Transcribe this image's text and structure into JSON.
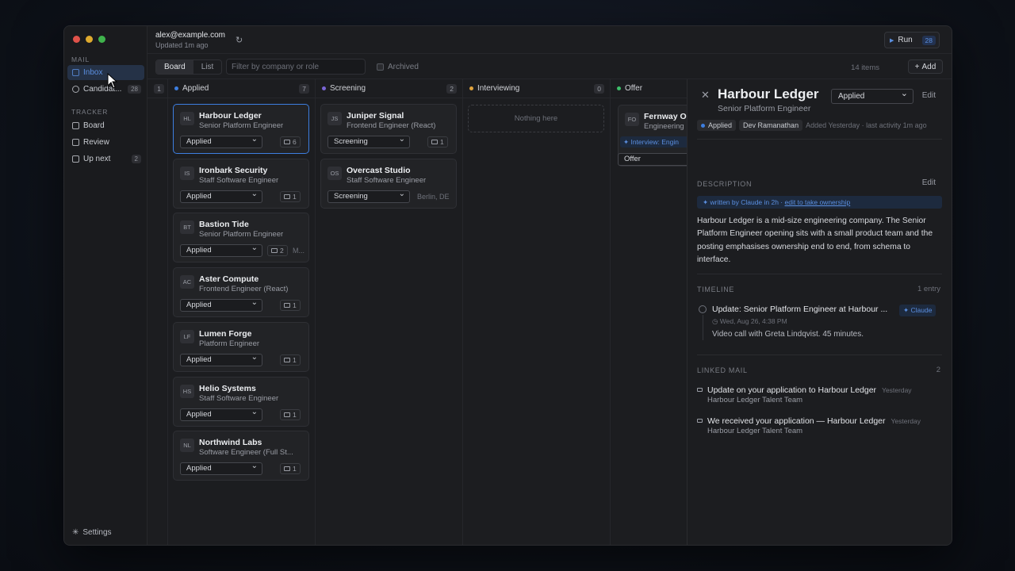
{
  "sidebar": {
    "mail_label": "MAIL",
    "tracker_label": "TRACKER",
    "items": [
      {
        "label": "Inbox"
      },
      {
        "label": "Candidat...",
        "count": "28"
      },
      {
        "label": "Board"
      },
      {
        "label": "Review"
      },
      {
        "label": "Up next",
        "count": "2"
      }
    ],
    "settings": "Settings"
  },
  "topbar": {
    "account": "alex@example.com",
    "updated": "Updated 1m ago",
    "run_label": "Run",
    "run_count": "28"
  },
  "toolbar": {
    "view_board": "Board",
    "view_list": "List",
    "filter_placeholder": "Filter by company or role",
    "archived_label": "Archived",
    "items_count": "14 items",
    "add_label": "Add"
  },
  "columns": [
    {
      "name": "",
      "count": "1"
    },
    {
      "name": "Applied",
      "count": "7",
      "color": "#3d7ee0"
    },
    {
      "name": "Screening",
      "count": "2",
      "color": "#7a66d6"
    },
    {
      "name": "Interviewing",
      "count": "0",
      "color": "#e0a33d",
      "empty_text": "Nothing here"
    },
    {
      "name": "Offer",
      "color": "#3dbf6a"
    }
  ],
  "applied_cards": [
    {
      "initials": "HL",
      "name": "Harbour Ledger",
      "role": "Senior Platform Engineer",
      "stage": "Applied",
      "mail": "6"
    },
    {
      "initials": "IS",
      "name": "Ironbark Security",
      "role": "Staff Software Engineer",
      "stage": "Applied",
      "mail": "1"
    },
    {
      "initials": "BT",
      "name": "Bastion Tide",
      "role": "Senior Platform Engineer",
      "stage": "Applied",
      "mail": "2",
      "extra": "M..."
    },
    {
      "initials": "AC",
      "name": "Aster Compute",
      "role": "Frontend Engineer (React)",
      "stage": "Applied",
      "mail": "1"
    },
    {
      "initials": "LF",
      "name": "Lumen Forge",
      "role": "Platform Engineer",
      "stage": "Applied",
      "mail": "1"
    },
    {
      "initials": "HS",
      "name": "Helio Systems",
      "role": "Staff Software Engineer",
      "stage": "Applied",
      "mail": "1"
    },
    {
      "initials": "NL",
      "name": "Northwind Labs",
      "role": "Software Engineer (Full St...",
      "stage": "Applied",
      "mail": "1"
    }
  ],
  "screening_cards": [
    {
      "initials": "JS",
      "name": "Juniper Signal",
      "role": "Frontend Engineer (React)",
      "stage": "Screening",
      "mail": "1"
    },
    {
      "initials": "OS",
      "name": "Overcast Studio",
      "role": "Staff Software Engineer",
      "stage": "Screening",
      "extra": "Berlin, DE"
    }
  ],
  "offer_cards": [
    {
      "initials": "FO",
      "name": "Fernway Op",
      "role": "Engineering",
      "note": "Interview: Engin",
      "stage": "Offer"
    }
  ],
  "detail": {
    "title": "Harbour Ledger",
    "subtitle": "Senior Platform Engineer",
    "stage": "Applied",
    "edit": "Edit",
    "tag_stage": "Applied",
    "tag_person": "Dev Ramanathan",
    "meta": "Added Yesterday · last activity 1m ago",
    "description_label": "DESCRIPTION",
    "description_edit": "Edit",
    "claude_note": "written by Claude in 2h · ",
    "claude_link": "edit to take ownership",
    "description": "Harbour Ledger is a mid-size engineering company. The Senior Platform Engineer opening sits with a small product team and the posting emphasises ownership end to end, from schema to interface.",
    "timeline_label": "TIMELINE",
    "timeline_count": "1 entry",
    "timeline": {
      "title": "Update: Senior Platform Engineer at Harbour ...",
      "badge": "Claude",
      "date": "Wed, Aug 26, 4:38 PM",
      "note": "Video call with Greta Lindqvist. 45 minutes."
    },
    "linked_label": "LINKED MAIL",
    "linked_count": "2",
    "linked": [
      {
        "subject": "Update on your application to Harbour Ledger",
        "when": "Yesterday",
        "from": "Harbour Ledger Talent Team"
      },
      {
        "subject": "We received your application — Harbour Ledger",
        "when": "Yesterday",
        "from": "Harbour Ledger Talent Team"
      }
    ]
  }
}
